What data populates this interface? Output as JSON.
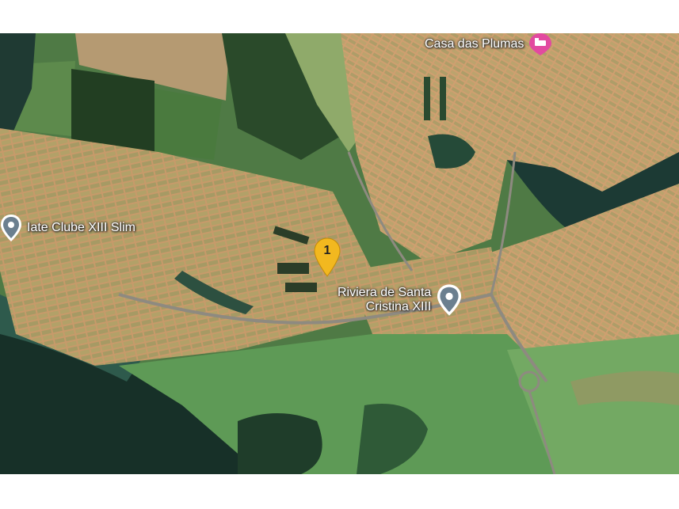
{
  "map": {
    "type": "satellite",
    "places": [
      {
        "name": "Casa das Plumas",
        "icon": "hotel-icon",
        "color": "#e24aa0"
      },
      {
        "name": "Iate Clube XIII Slim",
        "icon": "location-pin-icon",
        "color": "#6b7f8f"
      },
      {
        "name_line1": "Riviera de Santa",
        "name_line2": "Cristina XIII",
        "icon": "location-pin-icon",
        "color": "#6b7f8f"
      }
    ],
    "marker": {
      "label": "1",
      "icon": "numbered-pin-icon",
      "color": "#f2b81f"
    }
  }
}
